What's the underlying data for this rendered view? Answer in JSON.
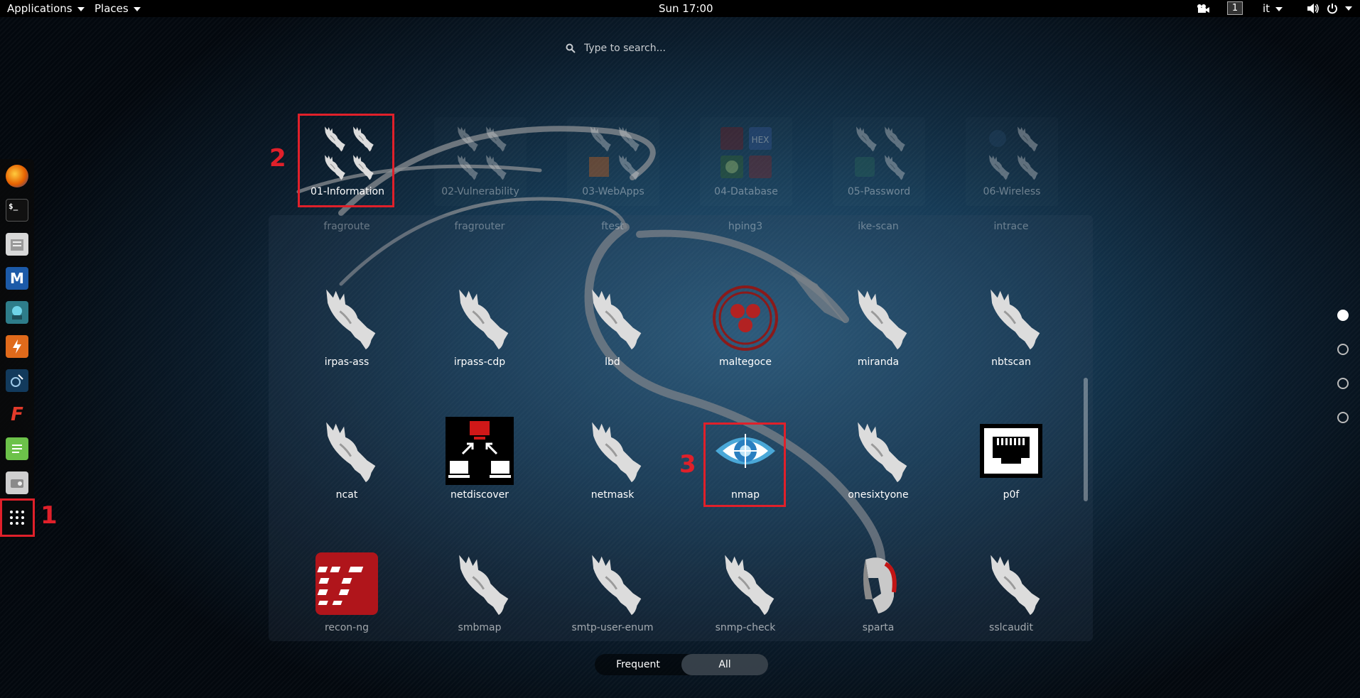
{
  "topbar": {
    "applications": "Applications",
    "places": "Places",
    "clock": "Sun 17:00",
    "workspace": "1",
    "language": "it"
  },
  "search": {
    "placeholder": "Type to search..."
  },
  "dock": {
    "items": [
      "firefox-icon",
      "terminal-icon",
      "files-icon",
      "metasploit-icon",
      "armitage-icon",
      "burpsuite-icon",
      "beef-icon",
      "faraday-icon",
      "leafpad-icon",
      "settings-icon"
    ],
    "show_apps_icon": "show-apps-grid-icon"
  },
  "annotations": [
    "1",
    "2",
    "3"
  ],
  "categories": [
    {
      "label": "01-Information"
    },
    {
      "label": "02-Vulnerability"
    },
    {
      "label": "03-WebApps"
    },
    {
      "label": "04-Database"
    },
    {
      "label": "05-Password"
    },
    {
      "label": "06-Wireless"
    }
  ],
  "partial_row": [
    "fragroute",
    "fragrouter",
    "ftest",
    "hping3",
    "ike-scan",
    "intrace"
  ],
  "apps": [
    {
      "label": "irpas-ass",
      "icon": "kali-dragon-icon"
    },
    {
      "label": "irpass-cdp",
      "icon": "kali-dragon-icon"
    },
    {
      "label": "lbd",
      "icon": "kali-dragon-icon"
    },
    {
      "label": "maltegoce",
      "icon": "maltego-icon"
    },
    {
      "label": "miranda",
      "icon": "kali-dragon-icon"
    },
    {
      "label": "nbtscan",
      "icon": "kali-dragon-icon"
    },
    {
      "label": "ncat",
      "icon": "kali-dragon-icon"
    },
    {
      "label": "netdiscover",
      "icon": "netdiscover-icon"
    },
    {
      "label": "netmask",
      "icon": "kali-dragon-icon"
    },
    {
      "label": "nmap",
      "icon": "nmap-eye-icon"
    },
    {
      "label": "onesixtyone",
      "icon": "kali-dragon-icon"
    },
    {
      "label": "p0f",
      "icon": "network-port-icon"
    },
    {
      "label": "recon-ng",
      "icon": "recon-ng-icon"
    },
    {
      "label": "smbmap",
      "icon": "kali-dragon-icon"
    },
    {
      "label": "smtp-user-enum",
      "icon": "kali-dragon-icon"
    },
    {
      "label": "snmp-check",
      "icon": "kali-dragon-icon"
    },
    {
      "label": "sparta",
      "icon": "sparta-helmet-icon"
    },
    {
      "label": "sslcaudit",
      "icon": "kali-dragon-icon"
    }
  ],
  "view_switch": {
    "frequent": "Frequent",
    "all": "All"
  },
  "colors": {
    "annotation": "#e0202a",
    "background": "#163a55",
    "topbar": "#000000"
  }
}
